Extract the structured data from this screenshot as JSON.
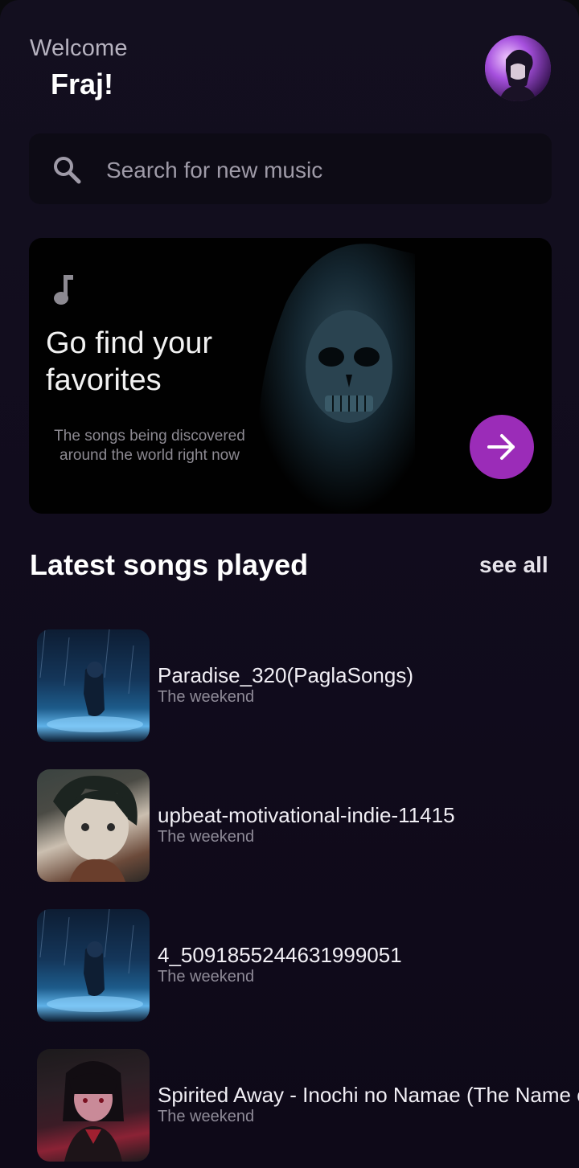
{
  "header": {
    "welcome": "Welcome",
    "username": "Fraj!"
  },
  "search": {
    "placeholder": "Search for new music",
    "icon": "search-icon"
  },
  "hero": {
    "icon": "music-note-icon",
    "title_line1": "Go find your",
    "title_line2": "favorites",
    "subtitle_line1": "The songs being discovered",
    "subtitle_line2": "around the world right now",
    "button_icon": "arrow-right-icon",
    "accent_color": "#9b2cb8"
  },
  "latest": {
    "title": "Latest songs played",
    "see_all": "see all",
    "songs": [
      {
        "title": "Paradise_320(PaglaSongs)",
        "artist": "The weekend"
      },
      {
        "title": "upbeat-motivational-indie-11415",
        "artist": "The weekend"
      },
      {
        "title": "4_5091855244631999051",
        "artist": "The weekend"
      },
      {
        "title": "Spirited Away - Inochi no Namae (The Name of Life)",
        "artist": "The weekend"
      }
    ]
  }
}
